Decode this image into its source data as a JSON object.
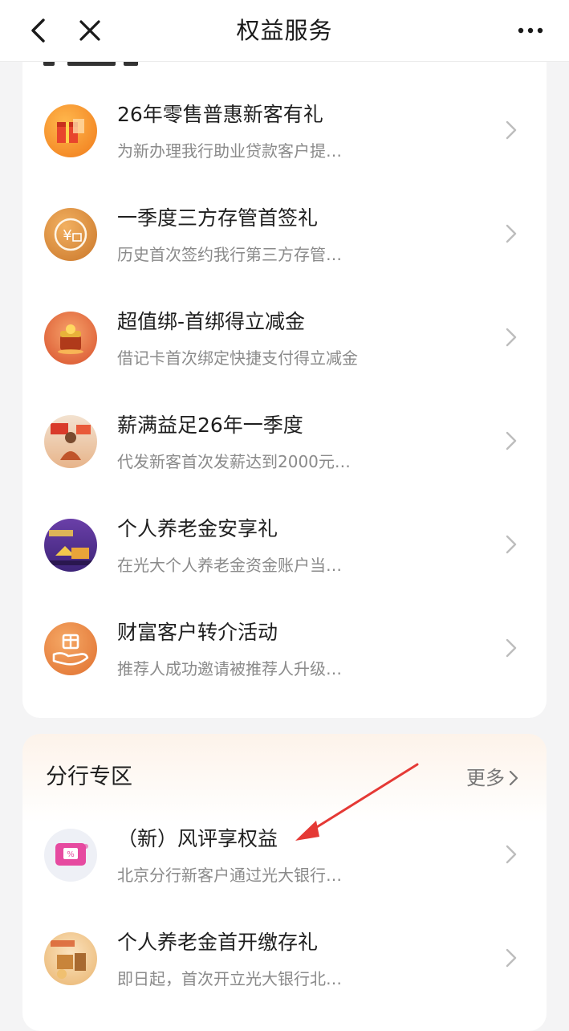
{
  "header": {
    "title": "权益服务"
  },
  "colors": {
    "accent_red": "#e53935",
    "chevron": "#bdbdbd"
  },
  "benefits": [
    {
      "title": "26年零售普惠新客有礼",
      "desc": "为新办理我行助业贷款客户提…",
      "icon": "gift-box-icon"
    },
    {
      "title": "一季度三方存管首签礼",
      "desc": "历史首次签约我行第三方存管…",
      "icon": "yuan-coin-icon"
    },
    {
      "title": "超值绑-首绑得立减金",
      "desc": "借记卡首次绑定快捷支付得立减金",
      "icon": "treasure-chest-icon"
    },
    {
      "title": "薪满益足26年一季度",
      "desc": "代发新客首次发薪达到2000元…",
      "icon": "person-promo-icon"
    },
    {
      "title": "个人养老金安享礼",
      "desc": "在光大个人养老金资金账户当…",
      "icon": "pension-banner-icon"
    },
    {
      "title": "财富客户转介活动",
      "desc": "推荐人成功邀请被推荐人升级…",
      "icon": "hand-gift-icon"
    }
  ],
  "branch": {
    "title": "分行专区",
    "more": "更多",
    "items": [
      {
        "title": "（新）风评享权益",
        "desc": "北京分行新客户通过光大银行…",
        "icon": "coupon-icon"
      },
      {
        "title": "个人养老金首开缴存礼",
        "desc": "即日起，首次开立光大银行北…",
        "icon": "pension-gift-icon"
      }
    ]
  }
}
